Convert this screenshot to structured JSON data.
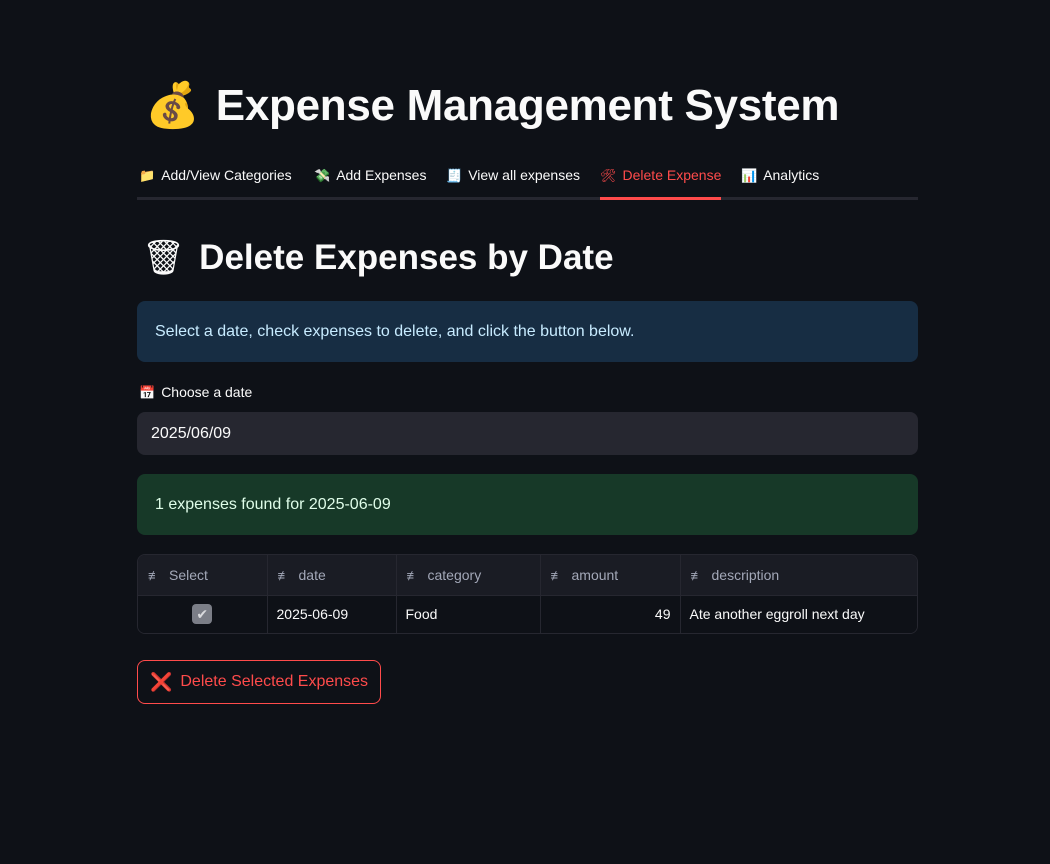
{
  "header": {
    "icon": "money-bag-icon",
    "icon_glyph": "💰",
    "title": "Expense Management System"
  },
  "tabs": [
    {
      "label": "Add/View Categories",
      "icon": "folder-icon",
      "glyph": "📁",
      "active": false
    },
    {
      "label": "Add Expenses",
      "icon": "money-wings-icon",
      "glyph": "💸",
      "active": false
    },
    {
      "label": "View all expenses",
      "icon": "receipt-icon",
      "glyph": "🧾",
      "active": false
    },
    {
      "label": "Delete Expense",
      "icon": "tools-icon",
      "glyph": "🛠",
      "active": true
    },
    {
      "label": "Analytics",
      "icon": "bar-chart-icon",
      "glyph": "📊",
      "active": false
    }
  ],
  "section": {
    "icon": "wastebasket-icon",
    "icon_glyph": "🗑",
    "title": "Delete Expenses by Date"
  },
  "info_message": "Select a date, check expenses to delete, and click the button below.",
  "date_picker": {
    "icon": "calendar-icon",
    "icon_glyph": "📅",
    "label": "Choose a date",
    "value": "2025/06/09"
  },
  "success_message": "1 expenses found for 2025-06-09",
  "table": {
    "columns": [
      "Select",
      "date",
      "category",
      "amount",
      "description"
    ],
    "rows": [
      {
        "select": true,
        "date": "2025-06-09",
        "category": "Food",
        "amount": "49",
        "description": "Ate another eggroll next day"
      }
    ]
  },
  "delete_button": {
    "icon": "cross-mark-icon",
    "icon_glyph": "❌",
    "label": "Delete Selected Expenses"
  },
  "colors": {
    "background": "#0e1117",
    "accent": "#ff4b4b",
    "info_bg": "#172d43",
    "success_bg": "#173928",
    "input_bg": "#262730"
  }
}
